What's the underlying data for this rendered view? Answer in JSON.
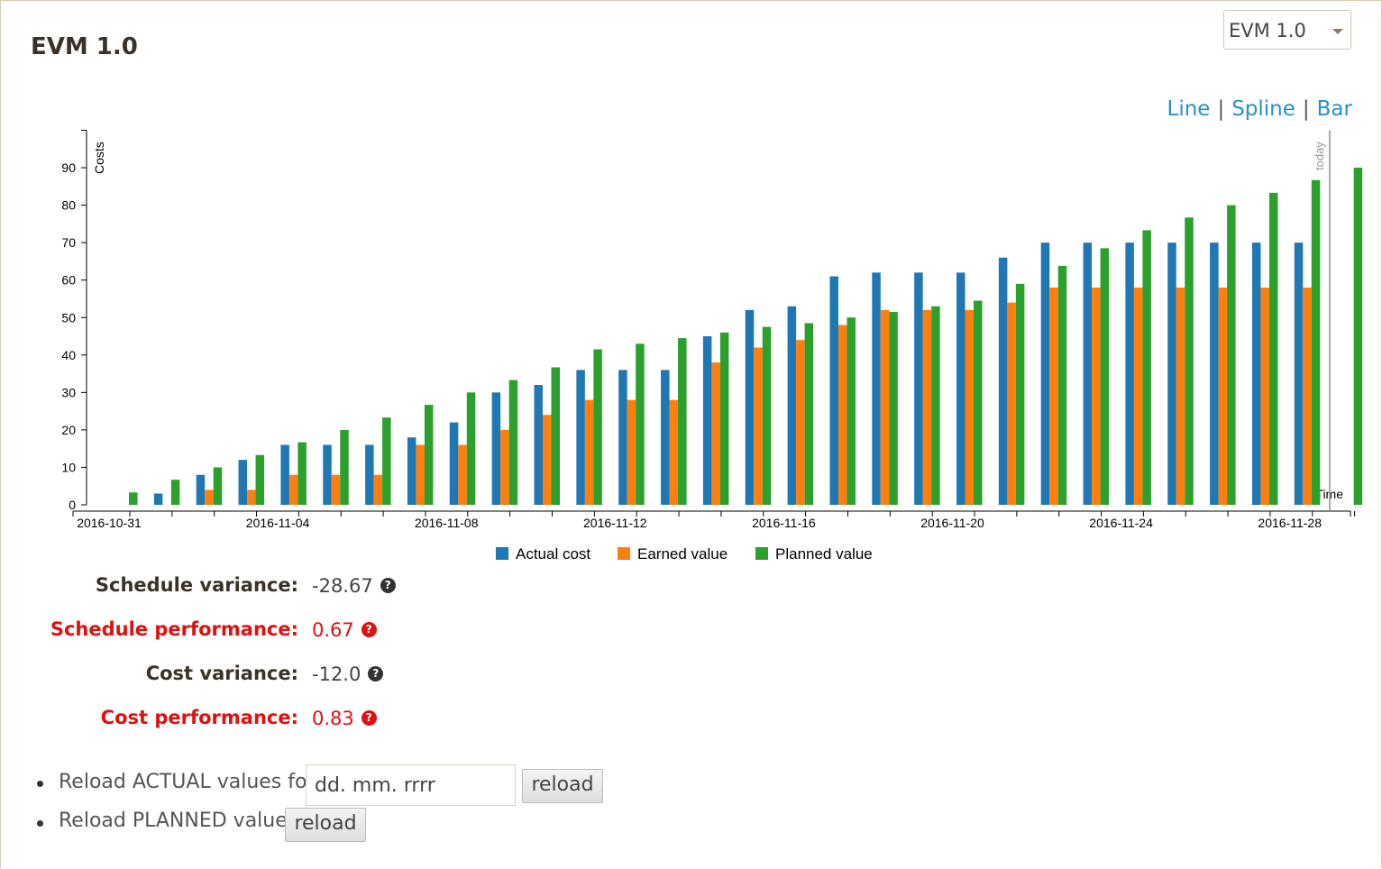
{
  "title": "EVM 1.0",
  "version_select": {
    "value": "EVM 1.0"
  },
  "chart_switcher": {
    "line": "Line",
    "spline": "Spline",
    "bar": "Bar",
    "separator": "|"
  },
  "chart_data": {
    "type": "bar",
    "ylabel": "Costs",
    "xlabel": "Time",
    "today_label": "today",
    "ylim": [
      0,
      100
    ],
    "yticks": [
      0,
      10,
      20,
      30,
      40,
      50,
      60,
      70,
      80,
      90
    ],
    "xtick_labels": [
      "2016-10-31",
      "2016-11-04",
      "2016-11-08",
      "2016-11-12",
      "2016-11-16",
      "2016-11-20",
      "2016-11-24",
      "2016-11-28"
    ],
    "grid": false,
    "legend_position": "bottom",
    "colors": {
      "actual": "#1f77b4",
      "earned": "#ff7f0e",
      "planned": "#2ca02c"
    },
    "series": [
      {
        "name": "Actual cost",
        "values": [
          0,
          3,
          8,
          12,
          16,
          16,
          16,
          18,
          22,
          30,
          32,
          36,
          36,
          36,
          45,
          52,
          53,
          61,
          62,
          62,
          62,
          66,
          70,
          70,
          70,
          70,
          70,
          70,
          70,
          null
        ]
      },
      {
        "name": "Earned value",
        "values": [
          0,
          0,
          4,
          4,
          8,
          8,
          8,
          16,
          16,
          20,
          24,
          28,
          28,
          28,
          38,
          42,
          44,
          48,
          52,
          52,
          52,
          54,
          58,
          58,
          58,
          58,
          58,
          58,
          58,
          null
        ]
      },
      {
        "name": "Planned value",
        "values": [
          3.3,
          6.7,
          10,
          13.3,
          16.7,
          20,
          23.3,
          26.7,
          30,
          33.3,
          36.7,
          41.5,
          43,
          44.5,
          46,
          47.5,
          48.5,
          50,
          51.5,
          53,
          54.5,
          59,
          63.8,
          68.5,
          73.3,
          76.7,
          80,
          83.3,
          86.7,
          90
        ]
      }
    ]
  },
  "stats": [
    {
      "label": "Schedule variance:",
      "value": "-28.67",
      "alert": false
    },
    {
      "label": "Schedule performance:",
      "value": "0.67",
      "alert": true
    },
    {
      "label": "Cost variance:",
      "value": "-12.0",
      "alert": false
    },
    {
      "label": "Cost performance:",
      "value": "0.83",
      "alert": true
    }
  ],
  "help_icon_glyph": "?",
  "reload": {
    "actual_label": "Reload ACTUAL values for:",
    "date_placeholder": "dd. mm. rrrr",
    "button_label": "reload",
    "planned_label": "Reload PLANNED values"
  }
}
